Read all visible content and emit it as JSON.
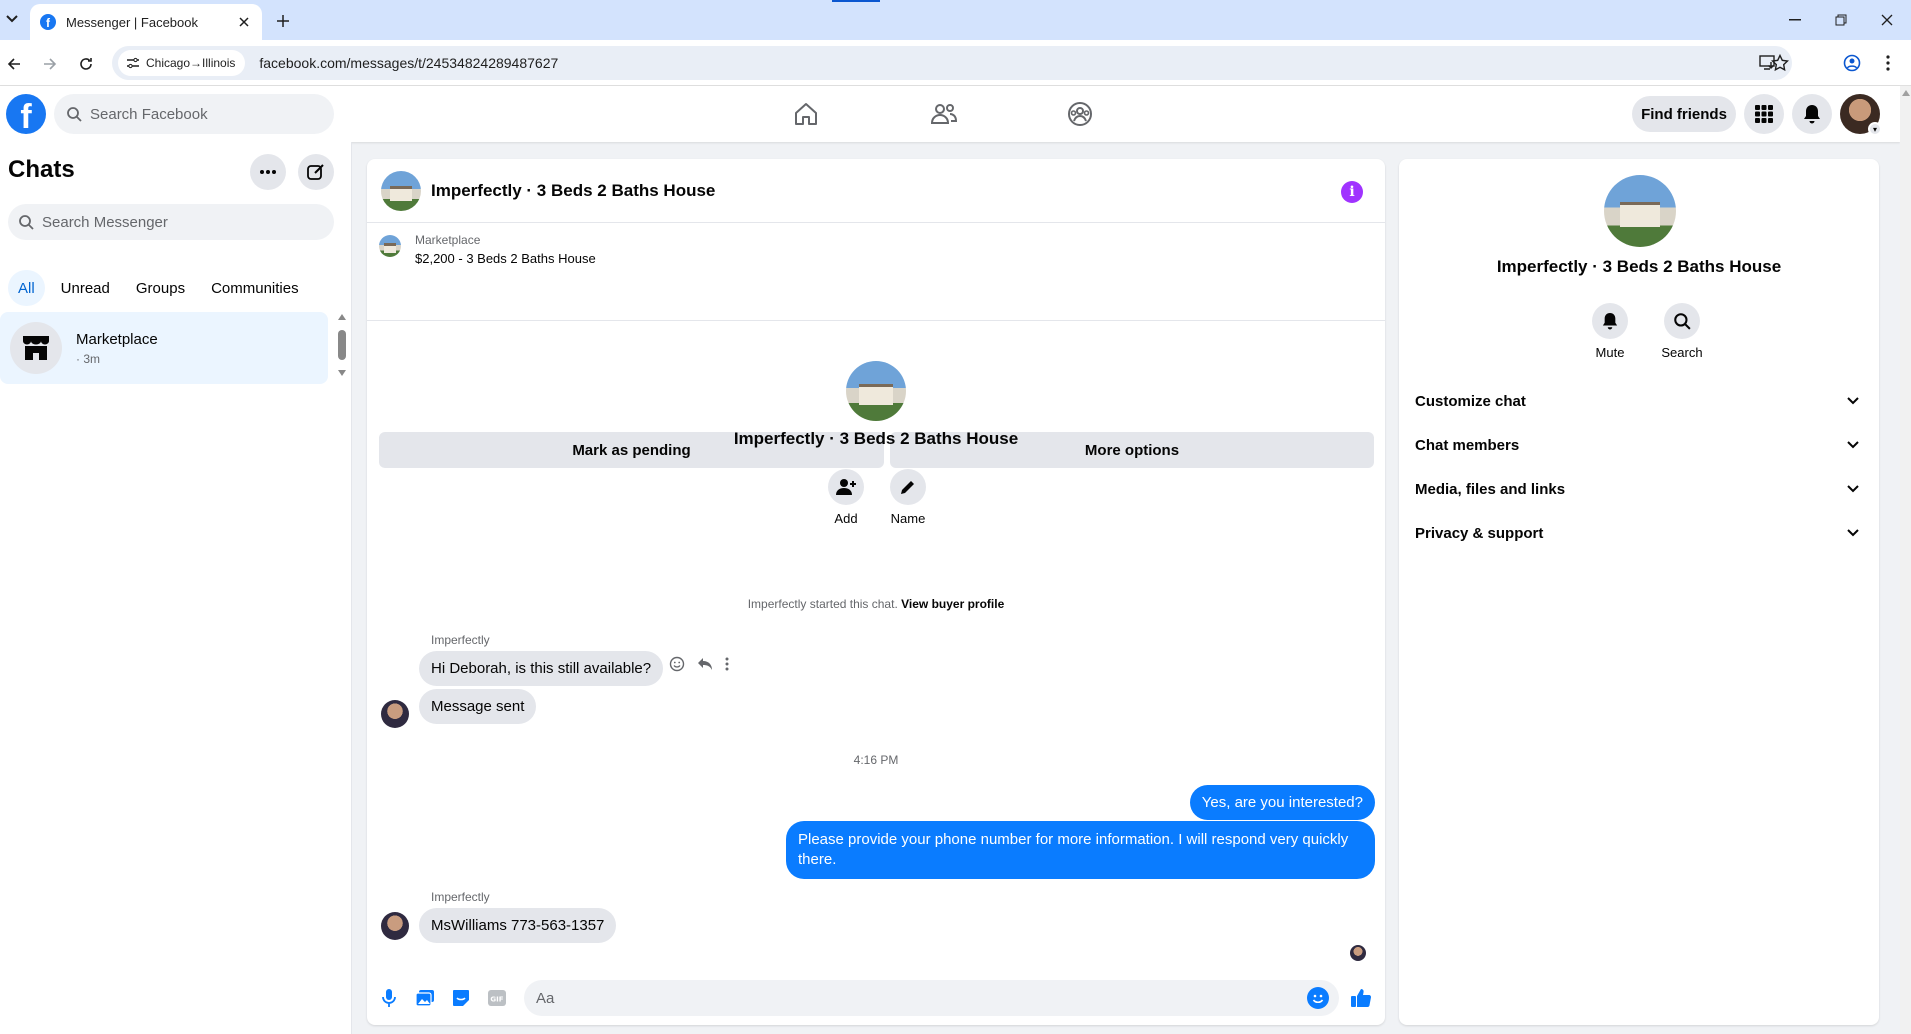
{
  "browser": {
    "tab_title": "Messenger | Facebook",
    "site_chip": "Chicago→Illinois",
    "url": "facebook.com/messages/t/24534824289487627"
  },
  "fb": {
    "logo": "f",
    "search_placeholder": "Search Facebook",
    "find_friends": "Find friends"
  },
  "chats": {
    "title": "Chats",
    "search_placeholder": "Search Messenger",
    "filters": [
      "All",
      "Unread",
      "Groups",
      "Communities"
    ],
    "items": [
      {
        "name": "Marketplace",
        "sub": "· 3m"
      }
    ]
  },
  "conversation": {
    "title": "Imperfectly · 3 Beds 2 Baths House",
    "marketplace_label": "Marketplace",
    "listing": "$2,200 - 3 Beds 2 Baths House",
    "mark_pending": "Mark as pending",
    "more_options": "More options",
    "center_name": "Imperfectly · 3 Beds 2 Baths House",
    "add_label": "Add",
    "name_label": "Name",
    "started_text": "Imperfectly started this chat.",
    "view_buyer": "View buyer profile",
    "sender_1": "Imperfectly",
    "msg_1": "Hi Deborah, is this still available?",
    "msg_2": "Message sent",
    "timestamp": "4:16 PM",
    "out_1": "Yes, are you interested?",
    "out_2": "Please provide your phone number for more information. I will respond very quickly there.",
    "sender_2": "Imperfectly",
    "msg_3": "MsWilliams 773-563-1357",
    "composer_placeholder": "Aa"
  },
  "details": {
    "name": "Imperfectly · 3 Beds 2 Baths House",
    "mute": "Mute",
    "search": "Search",
    "sections": [
      "Customize chat",
      "Chat members",
      "Media, files and links",
      "Privacy & support"
    ]
  },
  "colors": {
    "brand": "#1877f2",
    "bubble_out": "#0a7cff",
    "info": "#a033ff"
  }
}
